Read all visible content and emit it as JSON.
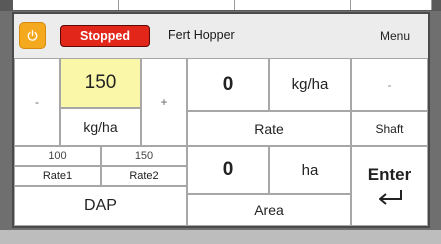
{
  "header": {
    "status": "Stopped",
    "product": "Fert Hopper",
    "menu_label": "Menu"
  },
  "target_rate": {
    "decrease_label": "-",
    "value": "150",
    "increase_label": "+",
    "unit": "kg/ha"
  },
  "actual_rate": {
    "value": "0",
    "unit": "kg/ha",
    "label": "Rate"
  },
  "shaft": {
    "value": "-",
    "label": "Shaft"
  },
  "presets": [
    {
      "value": "100",
      "label": "Rate1"
    },
    {
      "value": "150",
      "label": "Rate2"
    }
  ],
  "area": {
    "value": "0",
    "unit": "ha",
    "label": "Area"
  },
  "product_button": "DAP",
  "enter_label": "Enter",
  "colors": {
    "power": "#f5a91f",
    "stopped": "#e2271a",
    "target_highlight": "#fbf7a8"
  },
  "icons": [
    "power-icon",
    "enter-return-icon"
  ]
}
